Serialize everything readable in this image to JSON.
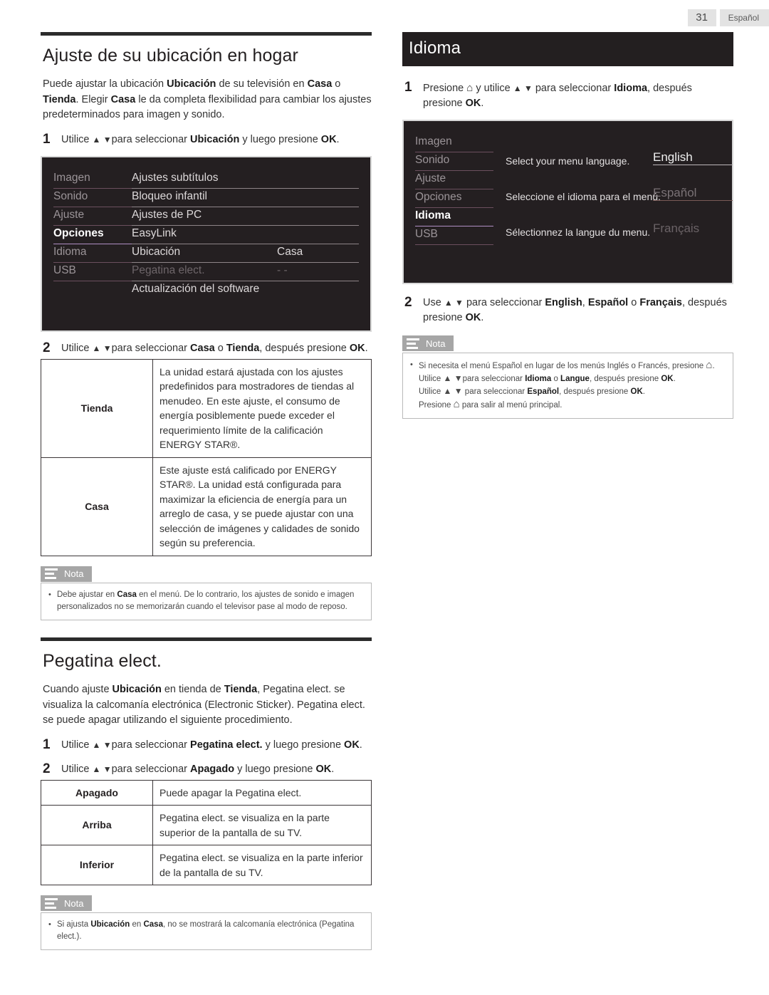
{
  "page_header": {
    "page_number": "31",
    "language": "Español"
  },
  "left_column": {
    "heading": "Ajuste de su ubicación en hogar",
    "intro": "Puede ajustar la ubicación <b>Ubicación</b> de su televisión en <b>Casa</b> o <b>Tienda</b>. Elegir <b>Casa</b> le da completa flexibilidad para cambiar los ajustes predeterminados para imagen y sonido.",
    "step1": {
      "num": "1",
      "text": "Utilice <ar>▲ ▼</ar>para seleccionar <b>Ubicación</b> y luego presione <b>OK</b>."
    },
    "osd": {
      "sidebar": [
        "Imagen",
        "Sonido",
        "Ajuste",
        "Opciones",
        "Idioma",
        "USB"
      ],
      "selected_sidebar": "Opciones",
      "middle": [
        "Ajustes subtítulos",
        "Bloqueo infantil",
        "Ajustes de PC",
        "EasyLink",
        "Ubicación",
        "Pegatina elect.",
        "Actualización del software"
      ],
      "dimmed_middle": [
        "Pegatina elect."
      ],
      "values": [
        "",
        "",
        "",
        "",
        "Casa",
        "- -",
        ""
      ]
    },
    "step2": {
      "num": "2",
      "text": "Utilice <ar>▲ ▼</ar>para seleccionar <b>Casa</b> o <b>Tienda</b>, después presione <b>OK</b>."
    },
    "location_table": [
      {
        "key": "Tienda",
        "desc": "La unidad estará ajustada con los ajustes predefinidos para mostradores de tiendas al menudeo. En este ajuste, el consumo de energía posiblemente puede exceder el requerimiento límite de la calificación ENERGY STAR®."
      },
      {
        "key": "Casa",
        "desc": "Este ajuste está calificado por ENERGY STAR®. La unidad está configurada para maximizar la eficiencia de energía para un arreglo de casa, y se puede ajustar con una selección de imágenes y calidades de sonido según su preferencia."
      }
    ],
    "nota1": {
      "label": "Nota",
      "items": [
        "Debe ajustar en <b>Casa</b> en el menú. De lo contrario, los ajustes de sonido e imagen personalizados no se memorizarán cuando el televisor pase al modo de reposo."
      ]
    },
    "heading2": "Pegatina elect.",
    "intro2": "Cuando ajuste <b>Ubicación</b> en tienda de <b>Tienda</b>, Pegatina elect. se visualiza la calcomanía electrónica (Electronic Sticker). Pegatina elect. se puede apagar utilizando el siguiente procedimiento.",
    "step3": {
      "num": "1",
      "text": "Utilice <ar>▲ ▼</ar>para seleccionar <b>Pegatina elect.</b> y luego presione <b>OK</b>."
    },
    "step4": {
      "num": "2",
      "text": "Utilice <ar>▲ ▼</ar>para seleccionar <b>Apagado</b> y luego presione <b>OK</b>."
    },
    "sticker_table": [
      {
        "key": "Apagado",
        "desc": "Puede apagar la Pegatina elect."
      },
      {
        "key": "Arriba",
        "desc": "Pegatina elect. se visualiza en la parte superior de la pantalla de su TV."
      },
      {
        "key": "Inferior",
        "desc": "Pegatina elect. se visualiza en la parte inferior de la pantalla de su TV."
      }
    ],
    "nota2": {
      "label": "Nota",
      "items": [
        "Si ajusta <b>Ubicación</b> en <b>Casa</b>, no se mostrará la calcomanía electrónica (Pegatina elect.)."
      ]
    }
  },
  "right_column": {
    "heading": "Idioma",
    "step1": {
      "num": "1",
      "text": "Presione <home>⌂</home> y utilice <ar>▲ ▼</ar> para seleccionar <b>Idioma</b>, después presione <b>OK</b>."
    },
    "osd": {
      "sidebar": [
        "Imagen",
        "Sonido",
        "Ajuste",
        "Opciones",
        "Idioma",
        "USB"
      ],
      "selected_sidebar": "Idioma",
      "descriptions": [
        "Select your menu language.",
        "Seleccione el idioma para el menú.",
        "Sélectionnez la langue du menu."
      ],
      "languages": [
        "English",
        "Español",
        "Français"
      ],
      "selected_language": "English"
    },
    "step2": {
      "num": "2",
      "text": "Use <ar>▲ ▼</ar> para seleccionar <b>English</b>, <b>Español</b> o <b>Français</b>, después presione <b>OK</b>."
    },
    "nota": {
      "label": "Nota",
      "items": [
        "Si necesita el menú Español en lugar de los menús Inglés o Francés, presione <home>⌂</home>.",
        "Utilice <ar>▲ ▼</ar>para seleccionar <b>Idioma</b> o <b>Langue</b>, después presione <b>OK</b>.",
        "Utilice <ar>▲ ▼</ar> para seleccionar <b>Español</b>, después presione <b>OK</b>.",
        "Presione <home>⌂</home> para salir al menú principal."
      ]
    }
  },
  "colors": {
    "osd_background": "#241f21",
    "osd_selected_underline": "#b08ec4",
    "osd_underline": "#6b4f5e",
    "dark_bar": "#231f20",
    "nota_tab": "#a6a6a6",
    "page_tab": "#e3e3e3"
  }
}
